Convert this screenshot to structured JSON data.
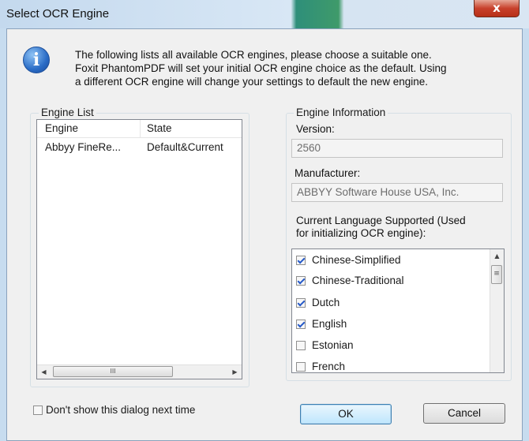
{
  "window": {
    "title": "Select OCR Engine",
    "close_label": "x"
  },
  "intro": {
    "line1": "The following lists all available OCR engines, please choose a suitable one.",
    "line2": "Foxit PhantomPDF will set your initial OCR engine choice as the default. Using",
    "line3": "a different OCR engine will change your settings to default the new engine.",
    "icon": "info-icon",
    "icon_glyph": "i"
  },
  "engine_list": {
    "group_label": "Engine List",
    "columns": [
      "Engine",
      "State"
    ],
    "rows": [
      {
        "engine": "Abbyy FineRe...",
        "state": "Default&Current"
      }
    ],
    "scroll_thumb_grip": "III"
  },
  "engine_info": {
    "group_label": "Engine Information",
    "version_label": "Version:",
    "version_value": "2560",
    "manufacturer_label": "Manufacturer:",
    "manufacturer_value": "ABBYY Software House USA, Inc.",
    "languages_label_line1": "Current Language Supported (Used",
    "languages_label_line2": "for initializing OCR engine):",
    "languages": [
      {
        "name": "Chinese-Simplified",
        "checked": true
      },
      {
        "name": "Chinese-Traditional",
        "checked": true
      },
      {
        "name": "Dutch",
        "checked": true
      },
      {
        "name": "English",
        "checked": true
      },
      {
        "name": "Estonian",
        "checked": false
      },
      {
        "name": "French",
        "checked": false
      }
    ]
  },
  "footer": {
    "dont_show_label": "Don't show this dialog next time",
    "dont_show_checked": false,
    "ok_label": "OK",
    "cancel_label": "Cancel"
  },
  "colors": {
    "titlebar": "#c4d9ee",
    "close_button": "#c8412c",
    "dialog_bg": "#f0f0f0",
    "default_button": "#bee6fd"
  }
}
